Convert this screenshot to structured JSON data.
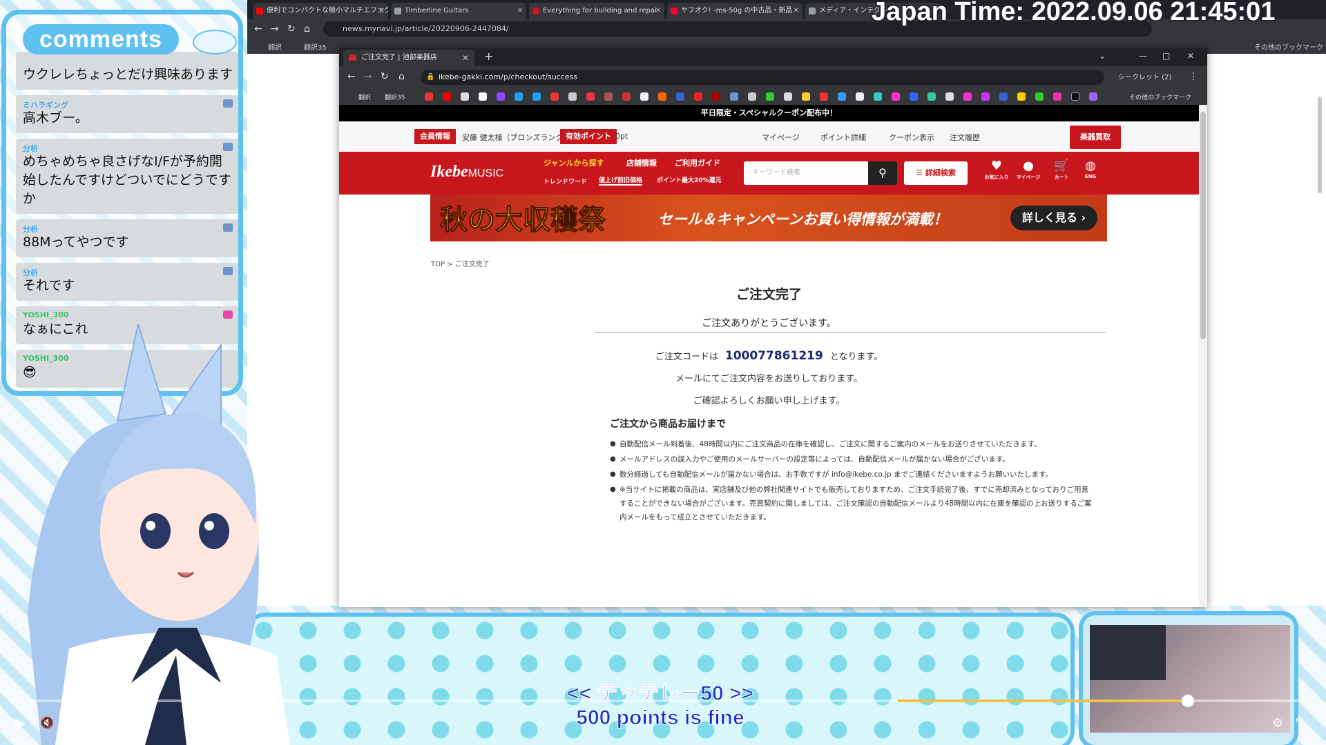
{
  "clock": "Japan Time: 2022.09.06 21:45:01",
  "comments": {
    "header": "comments",
    "items": [
      {
        "user": "",
        "text": "ウクレレちょっとだけ興味あります"
      },
      {
        "user": "ミハラギング",
        "text": "高木ブー。"
      },
      {
        "user": "分析",
        "text": "めちゃめちゃ良さげなI/Fが予約開始したんですけどついでにどうですか"
      },
      {
        "user": "分析",
        "text": "88Mってやつです"
      },
      {
        "user": "分析",
        "text": "それです"
      },
      {
        "user": "YOSHI_300",
        "text": "なぁにこれ"
      },
      {
        "user": "YOSHI_300",
        "text": "😎"
      }
    ]
  },
  "outer_browser": {
    "tabs": [
      {
        "label": "便利でコンパクトな極小マルチエフェクター",
        "color": "#ff0000"
      },
      {
        "label": "Timberline Guitars",
        "color": "#9aa0a6"
      },
      {
        "label": "Everything for building and repai",
        "color": "#c8161d"
      },
      {
        "label": "ヤフオク! -ms-50g の中古品・新品・",
        "color": "#ff0033"
      },
      {
        "label": "メディア・インテグレーション",
        "color": "#9aa0a6"
      }
    ],
    "url": "news.mynavi.jp/article/20220906-2447084/",
    "bookmarks": [
      "翻訳",
      "翻訳35",
      "その他のブックマーク"
    ]
  },
  "browser": {
    "tab_title": "ご注文完了 | 池部楽器店",
    "url": "ikebe-gakki.com/p/checkout/success",
    "profile": "シークレット (2)",
    "bookmarks_left": [
      "翻訳",
      "翻訳35"
    ],
    "bookmarks_right": "その他のブックマーク"
  },
  "site": {
    "promo": "平日限定・スペシャルクーポン配布中！",
    "member_label": "会員情報",
    "member_name": "安藤 健太様（ブロンズランク）",
    "points_label": "有効ポイント",
    "points_value": "0pt",
    "top_links": [
      "マイページ",
      "ポイント詳細",
      "クーポン表示",
      "注文履歴"
    ],
    "buyback": "楽器買取",
    "logo": "Ikebe",
    "logo_suffix": "MUSIC",
    "nav": [
      "ジャンルから探す",
      "店舗情報",
      "ご利用ガイド"
    ],
    "subnav": [
      "トレンドワード",
      "値上げ前旧価格",
      "ポイント最大20%還元"
    ],
    "search_placeholder": "キーワード検索",
    "adv_search": "詳細検索",
    "icons": [
      {
        "label": "お気に入り",
        "icon": "heart-icon"
      },
      {
        "label": "マイページ",
        "icon": "user-icon"
      },
      {
        "label": "カート",
        "icon": "cart-icon"
      },
      {
        "label": "ENG",
        "icon": "globe-icon"
      }
    ],
    "cart_count": "0",
    "banner_title": "秋の大収穫祭",
    "banner_sub": "セール＆キャンペーンお買い得情報が満載！",
    "banner_btn": "詳しく見る",
    "breadcrumb_top": "TOP",
    "breadcrumb_sep": ">",
    "breadcrumb_current": "ご注文完了",
    "title": "ご注文完了",
    "thanks": "ご注文ありがとうございます。",
    "order_prefix": "ご注文コードは",
    "order_code": "100077861219",
    "order_suffix": "となります。",
    "msg1": "メールにてご注文内容をお送りしております。",
    "msg2": "ご確認よろしくお願い申し上げます。",
    "section_title": "ご注文から商品お届けまで",
    "bullets": [
      "自動配信メール到着後、48時間以内にご注文商品の在庫を確認し、ご注文に関するご案内のメールをお送りさせていただきます。",
      "メールアドレスの誤入力やご使用のメールサーバーの設定等によっては、自動配信メールが届かない場合がございます。",
      "数分経過しても自動配信メールが届かない場合は、お手数ですが info@ikebe.co.jp までご連絡くださいますようお願いいたします。",
      "※当サイトに掲載の商品は、実店舗及び他の弊社関連サイトでも販売しておりますため、ご注文手続完了後、すでに売却済みとなっておりご用意することができない場合がございます。売買契約に関しましては、ご注文確認の自動配信メールより48時間以内に在庫を確認の上お送りするご案内メールをもって成立とさせていただきます。"
    ]
  },
  "captions": {
    "line1": "<< テッテレー50 >>",
    "line2": "500 points is fine"
  },
  "player": {
    "volume_level": 0.75
  }
}
